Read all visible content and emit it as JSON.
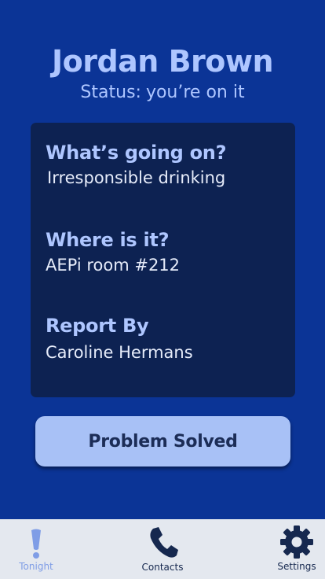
{
  "header": {
    "name": "Jordan Brown",
    "status_prefix": "Status:",
    "status_value": "you’re on it"
  },
  "details": {
    "what_label": "What’s going on?",
    "what_value": "Irresponsible drinking",
    "where_label": "Where is it?",
    "where_value": "AEPi room #212",
    "report_label": "Report By",
    "report_value": "Caroline Hermans"
  },
  "actions": {
    "solve_label": "Problem Solved"
  },
  "tabs": [
    {
      "label": "Tonight",
      "icon": "exclamation-icon",
      "active": true
    },
    {
      "label": "Contacts",
      "icon": "phone-icon",
      "active": false
    },
    {
      "label": "Settings",
      "icon": "gear-icon",
      "active": false
    }
  ],
  "colors": {
    "background": "#0b3496",
    "card": "#0d2252",
    "accent_text": "#aec6ff",
    "button": "#a8c1f6",
    "tab_bar": "#e4e8ef",
    "tab_active": "#7f9de6",
    "tab_inactive": "#16284f"
  }
}
